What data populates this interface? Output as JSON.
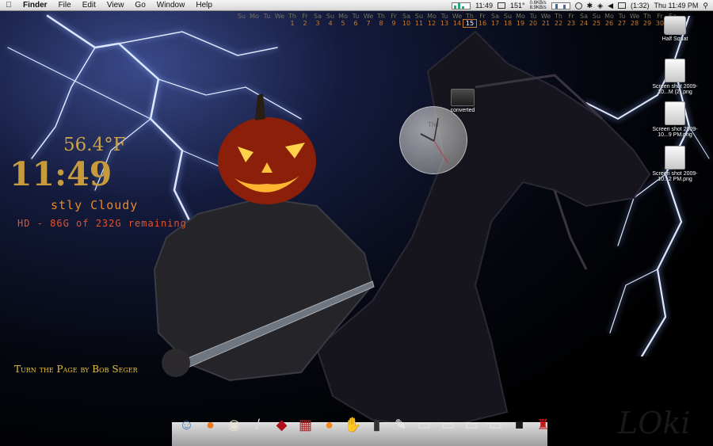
{
  "menubar": {
    "app_name": "Finder",
    "menus": [
      "File",
      "Edit",
      "View",
      "Go",
      "Window",
      "Help"
    ],
    "status_time": "11:49",
    "status_temp": "151°",
    "net_up": "0.6KB/s",
    "net_down": "8.9KB/s",
    "battery": "(1:32)",
    "datetime": "Thu 11:49 PM",
    "icons": [
      "apple-icon",
      "cpu-graph-icon",
      "memory-graph-icon",
      "network-graph-icon",
      "time-machine-icon",
      "bluetooth-icon",
      "wifi-icon",
      "volume-icon",
      "battery-icon",
      "spotlight-icon"
    ]
  },
  "calendar": {
    "days": [
      "Su",
      "Mo",
      "Tu",
      "We",
      "Th",
      "Fr",
      "Sa",
      "Su",
      "Mo",
      "Tu",
      "We",
      "Th",
      "Fr",
      "Sa",
      "Su",
      "Mo",
      "Tu",
      "We",
      "Th",
      "Fr",
      "Sa",
      "Su",
      "Mo",
      "Tu",
      "We",
      "Th",
      "Fr",
      "Sa",
      "Su",
      "Mo",
      "Tu",
      "We",
      "Th",
      "Fr",
      "Sa"
    ],
    "numbers": [
      "",
      "",
      "",
      "",
      "1",
      "2",
      "3",
      "4",
      "5",
      "6",
      "7",
      "8",
      "9",
      "10",
      "11",
      "12",
      "13",
      "14",
      "15",
      "16",
      "17",
      "18",
      "19",
      "20",
      "21",
      "22",
      "23",
      "24",
      "25",
      "26",
      "27",
      "28",
      "29",
      "30",
      "31"
    ],
    "today_index": 18
  },
  "weather": {
    "temperature": "56.4°F",
    "time": "11:49",
    "condition": "stly Cloudy",
    "disk": "HD - 86G of 232G remaining"
  },
  "now_playing": "Turn the Page by Bob Seger",
  "analog_clock": {
    "day": "Thu"
  },
  "desktop_icons": [
    {
      "label": "Half Squat",
      "kind": "drive-icon"
    },
    {
      "label": "converted",
      "kind": "folder-icon"
    },
    {
      "label": "Screen shot 2009-10...M (2).png",
      "kind": "png-file-icon"
    },
    {
      "label": "Screen shot 2009-10...9 PM.png",
      "kind": "png-file-icon"
    },
    {
      "label": "Screen shot 2009-10...2 PM.png",
      "kind": "png-file-icon"
    }
  ],
  "dock": [
    {
      "name": "finder-icon",
      "glyph": "☺",
      "color": "#4a76c8"
    },
    {
      "name": "pumpkin-icon",
      "glyph": "●",
      "color": "#e8781f"
    },
    {
      "name": "hockey-mask-icon",
      "glyph": "◉",
      "color": "#e9e3d5"
    },
    {
      "name": "bloody-knife-icon",
      "glyph": "/",
      "color": "#ddd"
    },
    {
      "name": "bloody-mask-icon",
      "glyph": "◆",
      "color": "#b0101a"
    },
    {
      "name": "freddy-sweater-icon",
      "glyph": "▦",
      "color": "#b32222"
    },
    {
      "name": "jack-o-lantern-icon",
      "glyph": "●",
      "color": "#f08a20"
    },
    {
      "name": "claw-glove-icon",
      "glyph": "✋",
      "color": "#b8a090"
    },
    {
      "name": "book-icon",
      "glyph": "▮",
      "color": "#333"
    },
    {
      "name": "bloody-paper-icon",
      "glyph": "✎",
      "color": "#eee"
    },
    {
      "name": "screenshot-thumb-icon",
      "glyph": "▭",
      "color": "#e5e5e5"
    },
    {
      "name": "screenshot-thumb-icon",
      "glyph": "▭",
      "color": "#e5e5e5"
    },
    {
      "name": "screenshot-thumb-icon",
      "glyph": "▭",
      "color": "#e5e5e5"
    },
    {
      "name": "screenshot-thumb-icon",
      "glyph": "▭",
      "color": "#e5e5e5"
    },
    {
      "name": "black-icon",
      "glyph": "■",
      "color": "#1a1a1a"
    },
    {
      "name": "bloody-trash-icon",
      "glyph": "♜",
      "color": "#c21b1b"
    }
  ],
  "signature": "LOki"
}
